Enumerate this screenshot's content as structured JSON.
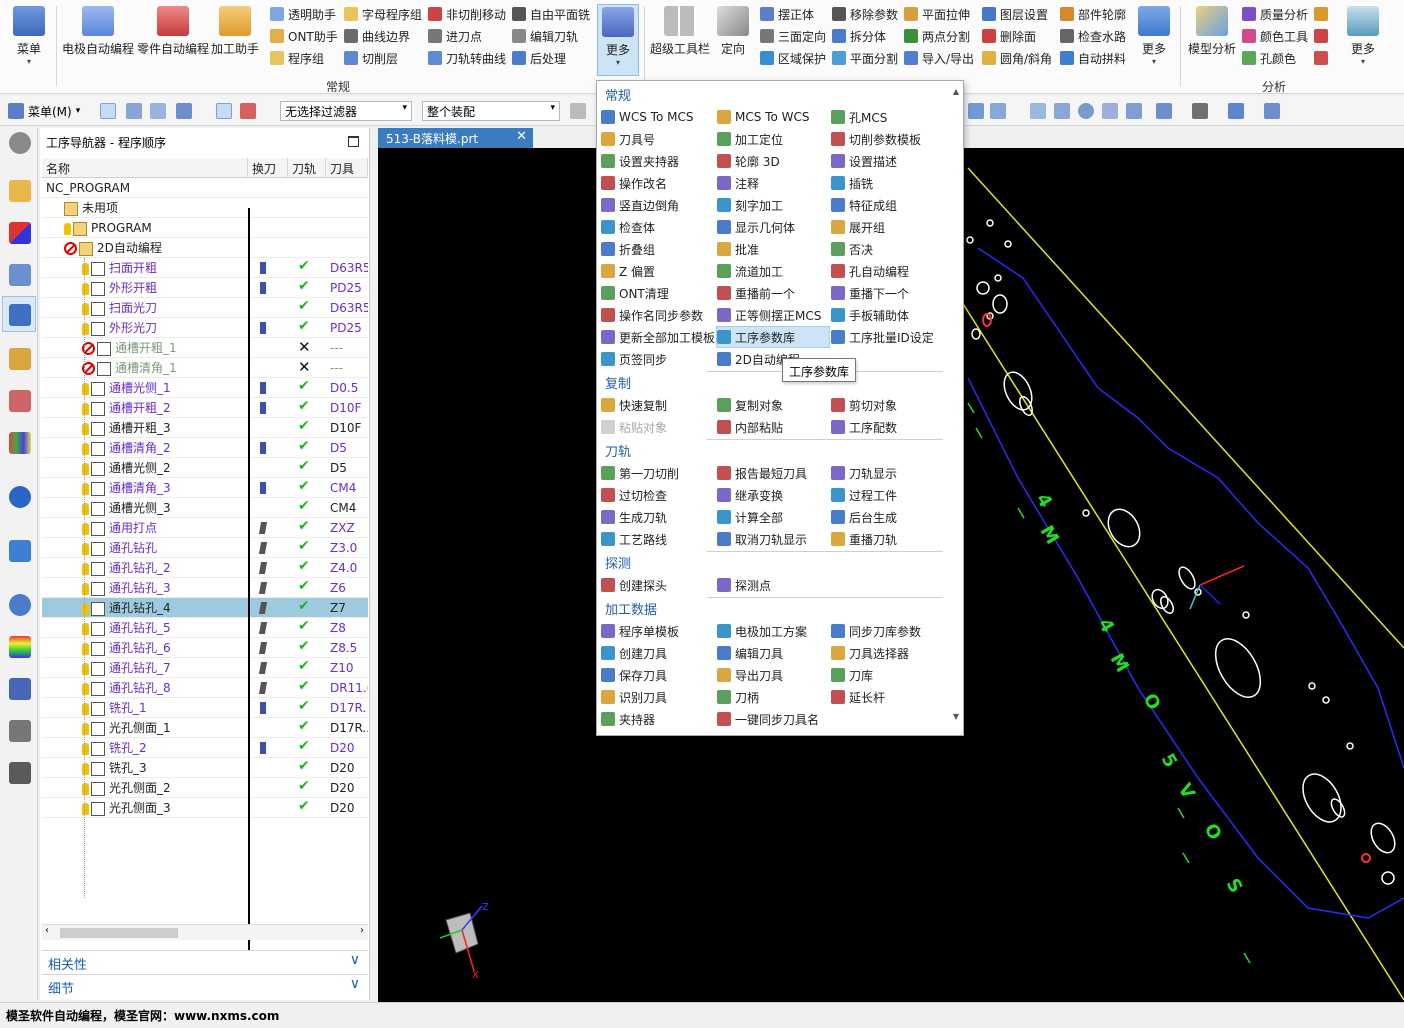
{
  "ribbon": {
    "big_buttons": [
      {
        "label": "菜单",
        "icon": "menu-icon",
        "color": "#4a78c8"
      },
      {
        "label": "电极自动编程",
        "icon": "electrode-icon",
        "color": "#5b86d9"
      },
      {
        "label": "零件自动编程",
        "icon": "part-program-icon",
        "color": "#d84b4b"
      },
      {
        "label": "加工助手",
        "icon": "machining-assistant-icon",
        "color": "#e8a33a"
      },
      {
        "label": "更多",
        "icon": "more-icon",
        "color": "#4a66c0"
      },
      {
        "label": "超级工具栏",
        "icon": "super-toolbar-icon",
        "color": "#9e9e9e"
      },
      {
        "label": "定向",
        "icon": "orient-icon",
        "color": "#7c7c7c"
      },
      {
        "label": "更多",
        "icon": "more-icon",
        "color": "#3f7ad0"
      },
      {
        "label": "模型分析",
        "icon": "model-analysis-icon",
        "color": "#c8a040"
      },
      {
        "label": "更多",
        "icon": "more-icon",
        "color": "#5a9ac0"
      }
    ],
    "small_col1": [
      "透明助手",
      "ONT助手",
      "程序组"
    ],
    "small_col2": [
      "字母程序组",
      "曲线边界",
      "切削层"
    ],
    "small_col3": [
      "非切削移动",
      "进刀点",
      "刀轨转曲线"
    ],
    "small_col4": [
      "自由平面铣",
      "编辑刀轨",
      "后处理"
    ],
    "small_col5": [
      "摆正体",
      "三面定向",
      "区域保护"
    ],
    "small_col6": [
      "移除参数",
      "拆分体",
      "平面分割"
    ],
    "small_col7": [
      "平面拉伸",
      "两点分割",
      "导入/导出"
    ],
    "small_col8": [
      "图层设置",
      "删除面",
      "圆角/斜角"
    ],
    "small_col9": [
      "部件轮廓",
      "检查水路",
      "自动拼料"
    ],
    "small_col10": [
      "质量分析",
      "颜色工具",
      "孔颜色"
    ],
    "group_labels": [
      "常规",
      "分析"
    ]
  },
  "toolbar": {
    "menu_label": "菜单(M)",
    "filter_value": "无选择过滤器",
    "assembly_value": "整个装配"
  },
  "navigator": {
    "title": "工序导航器 - 程序顺序",
    "columns": [
      "名称",
      "换刀",
      "刀轨",
      "刀具"
    ],
    "rows": [
      {
        "name": "NC_PROGRAM",
        "tool": "",
        "color": "normal",
        "indent": 0,
        "status": "none",
        "tc": "",
        "path": ""
      },
      {
        "name": "未用项",
        "tool": "",
        "color": "normal",
        "indent": 1,
        "status": "none",
        "tc": "",
        "path": ""
      },
      {
        "name": "PROGRAM",
        "tool": "",
        "color": "normal",
        "indent": 1,
        "status": "ok",
        "tc": "",
        "path": ""
      },
      {
        "name": "2D自动编程",
        "tool": "",
        "color": "normal",
        "indent": 1,
        "status": "no",
        "tc": "",
        "path": ""
      },
      {
        "name": "扫面开粗",
        "tool": "D63R5",
        "color": "purple",
        "indent": 2,
        "status": "ok",
        "tc": "a",
        "path": "check"
      },
      {
        "name": "外形开粗",
        "tool": "PD25",
        "color": "purple",
        "indent": 2,
        "status": "ok",
        "tc": "a",
        "path": "check"
      },
      {
        "name": "扫面光刀",
        "tool": "D63R5",
        "color": "purple",
        "indent": 2,
        "status": "ok",
        "tc": "",
        "path": "check"
      },
      {
        "name": "外形光刀",
        "tool": "PD25",
        "color": "purple",
        "indent": 2,
        "status": "ok",
        "tc": "a",
        "path": "check"
      },
      {
        "name": "通槽开粗_1",
        "tool": "---",
        "color": "gray",
        "indent": 2,
        "status": "no",
        "tc": "",
        "path": "x"
      },
      {
        "name": "通槽清角_1",
        "tool": "---",
        "color": "gray",
        "indent": 2,
        "status": "no",
        "tc": "",
        "path": "x"
      },
      {
        "name": "通槽光侧_1",
        "tool": "D0.5",
        "color": "purple",
        "indent": 2,
        "status": "ok",
        "tc": "a",
        "path": "check"
      },
      {
        "name": "通槽开粗_2",
        "tool": "D10F",
        "color": "purple",
        "indent": 2,
        "status": "ok",
        "tc": "a",
        "path": "check"
      },
      {
        "name": "通槽开粗_3",
        "tool": "D10F",
        "color": "normal",
        "indent": 2,
        "status": "ok",
        "tc": "",
        "path": "check"
      },
      {
        "name": "通槽清角_2",
        "tool": "D5",
        "color": "purple",
        "indent": 2,
        "status": "ok",
        "tc": "a",
        "path": "check"
      },
      {
        "name": "通槽光侧_2",
        "tool": "D5",
        "color": "normal",
        "indent": 2,
        "status": "ok",
        "tc": "",
        "path": "check"
      },
      {
        "name": "通槽清角_3",
        "tool": "CM4",
        "color": "purple",
        "indent": 2,
        "status": "ok",
        "tc": "a",
        "path": "check"
      },
      {
        "name": "通槽光侧_3",
        "tool": "CM4",
        "color": "normal",
        "indent": 2,
        "status": "ok",
        "tc": "",
        "path": "check"
      },
      {
        "name": "通用打点",
        "tool": "ZXZ",
        "color": "purple",
        "indent": 2,
        "status": "ok",
        "tc": "b",
        "path": "check"
      },
      {
        "name": "通孔钻孔",
        "tool": "Z3.0",
        "color": "purple",
        "indent": 2,
        "status": "ok",
        "tc": "b",
        "path": "check"
      },
      {
        "name": "通孔钻孔_2",
        "tool": "Z4.0",
        "color": "purple",
        "indent": 2,
        "status": "ok",
        "tc": "b",
        "path": "check"
      },
      {
        "name": "通孔钻孔_3",
        "tool": "Z6",
        "color": "purple",
        "indent": 2,
        "status": "ok",
        "tc": "b",
        "path": "check"
      },
      {
        "name": "通孔钻孔_4",
        "tool": "Z7",
        "color": "normal",
        "indent": 2,
        "status": "ok",
        "tc": "b",
        "path": "check"
      },
      {
        "name": "通孔钻孔_5",
        "tool": "Z8",
        "color": "purple",
        "indent": 2,
        "status": "ok",
        "tc": "b",
        "path": "check"
      },
      {
        "name": "通孔钻孔_6",
        "tool": "Z8.5",
        "color": "purple",
        "indent": 2,
        "status": "ok",
        "tc": "b",
        "path": "check"
      },
      {
        "name": "通孔钻孔_7",
        "tool": "Z10",
        "color": "purple",
        "indent": 2,
        "status": "ok",
        "tc": "b",
        "path": "check"
      },
      {
        "name": "通孔钻孔_8",
        "tool": "DR11.(",
        "color": "purple",
        "indent": 2,
        "status": "ok",
        "tc": "b",
        "path": "check"
      },
      {
        "name": "铣孔_1",
        "tool": "D17R.",
        "color": "purple",
        "indent": 2,
        "status": "ok",
        "tc": "a",
        "path": "check"
      },
      {
        "name": "光孔侧面_1",
        "tool": "D17R..",
        "color": "normal",
        "indent": 2,
        "status": "ok",
        "tc": "",
        "path": "check"
      },
      {
        "name": "铣孔_2",
        "tool": "D20",
        "color": "purple",
        "indent": 2,
        "status": "ok",
        "tc": "a",
        "path": "check"
      },
      {
        "name": "铣孔_3",
        "tool": "D20",
        "color": "normal",
        "indent": 2,
        "status": "ok",
        "tc": "",
        "path": "check"
      },
      {
        "name": "光孔侧面_2",
        "tool": "D20",
        "color": "normal",
        "indent": 2,
        "status": "ok",
        "tc": "",
        "path": "check"
      },
      {
        "name": "光孔侧面_3",
        "tool": "D20",
        "color": "normal",
        "indent": 2,
        "status": "ok",
        "tc": "",
        "path": "check"
      }
    ],
    "selected_row": 21,
    "panels": [
      "相关性",
      "细节"
    ]
  },
  "viewport": {
    "tab_title": "513-B落料模.prt",
    "part_labels": [
      "4",
      "M",
      "4",
      "M",
      "O",
      "5",
      "V",
      "O",
      "S"
    ],
    "axis_labels": [
      "Z",
      "X"
    ]
  },
  "menu": {
    "sections": [
      {
        "title": "常规",
        "items": [
          [
            "WCS To MCS",
            "MCS To WCS",
            "孔MCS"
          ],
          [
            "刀具号",
            "加工定位",
            "切削参数模板"
          ],
          [
            "设置夹持器",
            "轮廓 3D",
            "设置描述"
          ],
          [
            "操作改名",
            "注释",
            "插铣"
          ],
          [
            "竖直边倒角",
            "刻字加工",
            "特征成组"
          ],
          [
            "检查体",
            "显示几何体",
            "展开组"
          ],
          [
            "折叠组",
            "批准",
            "否决"
          ],
          [
            "Z 偏置",
            "流道加工",
            "孔自动编程"
          ],
          [
            "ONT清理",
            "重播前一个",
            "重播下一个"
          ],
          [
            "操作名同步参数",
            "正等侧摆正MCS",
            "手板辅助体"
          ],
          [
            "更新全部加工模板",
            "工序参数库",
            "工序批量ID设定"
          ],
          [
            "页签同步",
            "2D自动编程",
            ""
          ]
        ]
      },
      {
        "title": "复制",
        "items": [
          [
            "快速复制",
            "复制对象",
            "剪切对象"
          ],
          [
            "粘贴对象",
            "内部粘贴",
            "工序配数"
          ]
        ]
      },
      {
        "title": "刀轨",
        "items": [
          [
            "第一刀切削",
            "报告最短刀具",
            "刀轨显示"
          ],
          [
            "过切检查",
            "继承变换",
            "过程工件"
          ],
          [
            "生成刀轨",
            "计算全部",
            "后台生成"
          ],
          [
            "工艺路线",
            "取消刀轨显示",
            "重播刀轨"
          ]
        ]
      },
      {
        "title": "探测",
        "items": [
          [
            "创建探头",
            "探测点",
            ""
          ]
        ]
      },
      {
        "title": "加工数据",
        "items": [
          [
            "程序单模板",
            "电极加工方案",
            "同步刀库参数"
          ],
          [
            "创建刀具",
            "编辑刀具",
            "刀具选择器"
          ],
          [
            "保存刀具",
            "导出刀具",
            "刀库"
          ],
          [
            "识别刀具",
            "刀柄",
            "延长杆"
          ],
          [
            "夹持器",
            "一键同步刀具名",
            ""
          ]
        ]
      }
    ],
    "highlighted_item": "工序参数库",
    "disabled_item": "粘贴对象",
    "tooltip": "工序参数库"
  },
  "statusbar": {
    "text": "模圣软件自动编程，模圣官网：www.nxms.com"
  },
  "colors": {
    "accent": "#1f5fb0",
    "tab_bg": "#3b7bc0",
    "selected_row": "#9ecae0",
    "highlight": "#cde4f7",
    "viewport_bg": "#000000",
    "outline_blue": "#1a1aff",
    "outline_yellow": "#e6e600",
    "label_green": "#22dd22"
  }
}
